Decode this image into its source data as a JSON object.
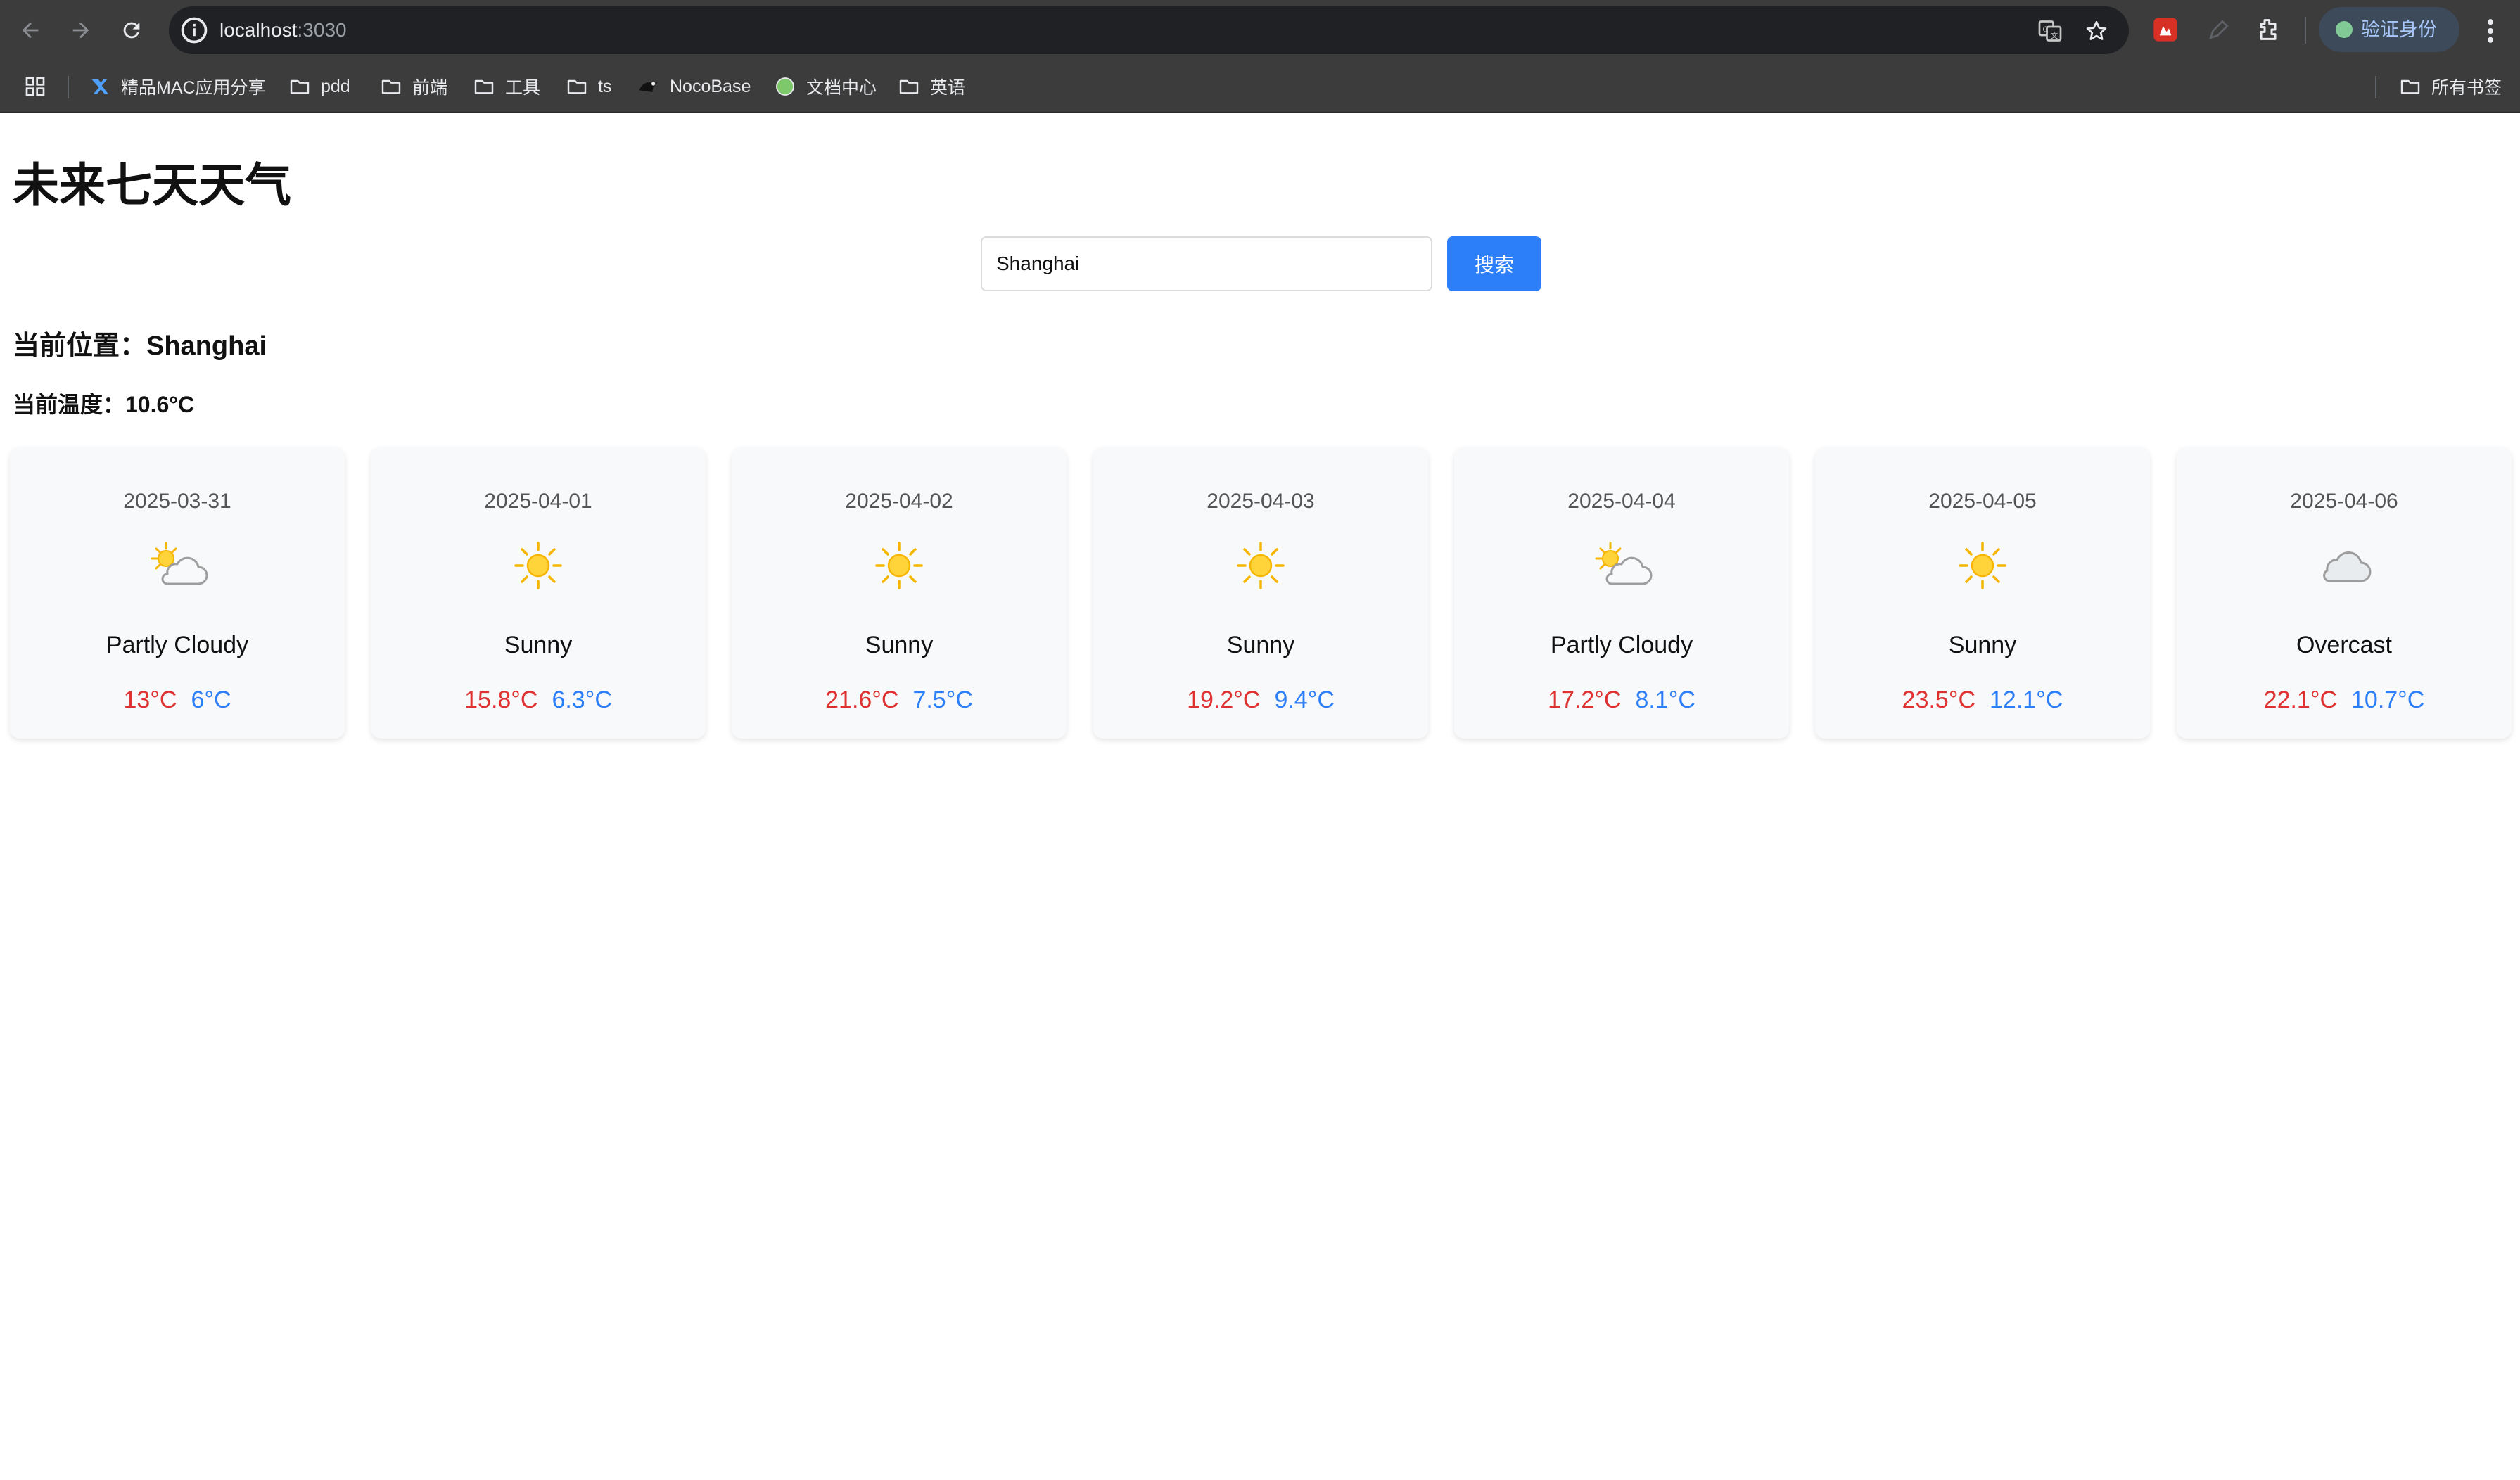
{
  "browser": {
    "url_host": "localhost",
    "url_port": ":3030",
    "profile_label": "验证身份",
    "icons": [
      "back-icon",
      "forward-icon",
      "reload-icon",
      "site-info-icon",
      "translate-icon",
      "star-icon",
      "extension-icon",
      "puzzle-icon",
      "more-icon"
    ]
  },
  "bookmarks": {
    "items": [
      {
        "label": "精品MAC应用分享",
        "icon": "app-logo-icon"
      },
      {
        "label": "pdd",
        "icon": "folder-icon"
      },
      {
        "label": "前端",
        "icon": "folder-icon"
      },
      {
        "label": "工具",
        "icon": "folder-icon"
      },
      {
        "label": "ts",
        "icon": "folder-icon"
      },
      {
        "label": "NocoBase",
        "icon": "nocobase-icon"
      },
      {
        "label": "文档中心",
        "icon": "globe-icon"
      },
      {
        "label": "英语",
        "icon": "folder-icon"
      }
    ],
    "all_bookmarks": "所有书签"
  },
  "page": {
    "title": "未来七天天气",
    "search": {
      "value": "Shanghai",
      "button_label": "搜索"
    },
    "location_text": "当前位置：Shanghai",
    "temperature_text": "当前温度：10.6°C"
  },
  "forecast": [
    {
      "date": "2025-03-31",
      "condition": "Partly Cloudy",
      "icon": "partly-cloudy-icon",
      "max": "13°C",
      "min": "6°C"
    },
    {
      "date": "2025-04-01",
      "condition": "Sunny",
      "icon": "sun-icon",
      "max": "15.8°C",
      "min": "6.3°C"
    },
    {
      "date": "2025-04-02",
      "condition": "Sunny",
      "icon": "sun-icon",
      "max": "21.6°C",
      "min": "7.5°C"
    },
    {
      "date": "2025-04-03",
      "condition": "Sunny",
      "icon": "sun-icon",
      "max": "19.2°C",
      "min": "9.4°C"
    },
    {
      "date": "2025-04-04",
      "condition": "Partly Cloudy",
      "icon": "partly-cloudy-icon",
      "max": "17.2°C",
      "min": "8.1°C"
    },
    {
      "date": "2025-04-05",
      "condition": "Sunny",
      "icon": "sun-icon",
      "max": "23.5°C",
      "min": "12.1°C"
    },
    {
      "date": "2025-04-06",
      "condition": "Overcast",
      "icon": "cloud-icon",
      "max": "22.1°C",
      "min": "10.7°C"
    }
  ],
  "colors": {
    "accent": "#2d7ff9",
    "max_temp": "#e03131",
    "min_temp": "#2d7ff9"
  }
}
